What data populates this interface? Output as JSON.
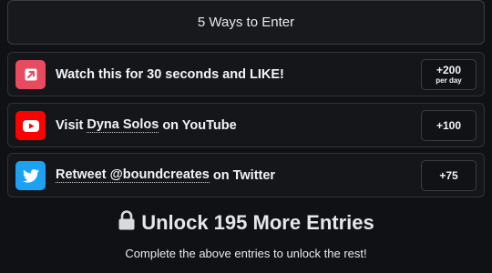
{
  "header": {
    "title": "5 Ways to Enter"
  },
  "entries": [
    {
      "icon": "link-arrow-icon",
      "color": "#e84a5f",
      "text": "Watch this for 30 seconds and LIKE!",
      "points": "+200",
      "points_sub": "per day"
    },
    {
      "icon": "youtube-icon",
      "color": "#ff0000",
      "text_before": "Visit",
      "link": "Dyna Solos",
      "text_after": "on YouTube",
      "points": "+100"
    },
    {
      "icon": "twitter-icon",
      "color": "#1da1f2",
      "link": "Retweet @boundcreates",
      "text_after": "on Twitter",
      "points": "+75"
    }
  ],
  "unlock": {
    "icon": "lock-icon",
    "title": "Unlock 195 More Entries",
    "subtitle": "Complete the above entries to unlock the rest!"
  }
}
